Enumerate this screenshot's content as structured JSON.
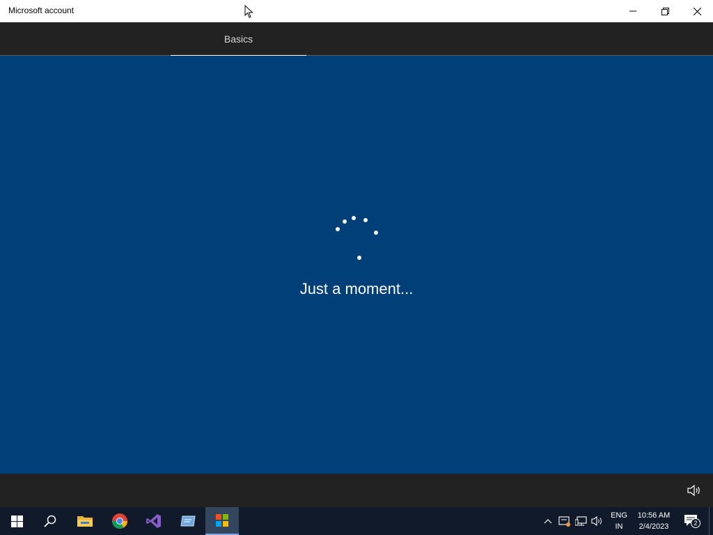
{
  "window": {
    "title": "Microsoft account",
    "controls": {
      "minimize": "minimize-icon",
      "maximize": "restore-icon",
      "close": "close-icon"
    }
  },
  "tabs": [
    {
      "label": "Basics",
      "active": true
    }
  ],
  "main": {
    "loading_text": "Just a moment...",
    "spinner": "loading-spinner"
  },
  "bottombar": {
    "volume_icon": "volume-icon"
  },
  "taskbar": {
    "items": [
      {
        "name": "start",
        "icon": "windows-logo-icon"
      },
      {
        "name": "search",
        "icon": "search-icon"
      },
      {
        "name": "file-explorer",
        "icon": "folder-icon"
      },
      {
        "name": "chrome",
        "icon": "chrome-icon"
      },
      {
        "name": "visual-studio",
        "icon": "visual-studio-icon"
      },
      {
        "name": "app",
        "icon": "app-icon"
      },
      {
        "name": "store",
        "icon": "store-icon",
        "active": true
      }
    ],
    "tray": {
      "language_line1": "ENG",
      "language_line2": "IN",
      "time": "10:56 AM",
      "date": "2/4/2023",
      "notification_count": "2"
    }
  },
  "colors": {
    "main_bg": "#003f77",
    "bar_bg": "#222222",
    "taskbar_bg": "#101a2a",
    "accent": "#76a9e6"
  }
}
